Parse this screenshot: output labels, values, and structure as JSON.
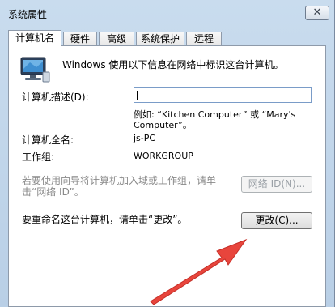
{
  "window": {
    "title": "系统属性"
  },
  "tabs": [
    {
      "label": "计算机名",
      "active": true
    },
    {
      "label": "硬件"
    },
    {
      "label": "高级"
    },
    {
      "label": "系统保护"
    },
    {
      "label": "远程"
    }
  ],
  "panel": {
    "intro": "Windows 使用以下信息在网络中标识这台计算机。",
    "desc_label": "计算机描述(D):",
    "desc_value": "",
    "example_line1": "例如: “Kitchen Computer” 或 “Mary's",
    "example_line2": "Computer”。",
    "fullname_label": "计算机全名:",
    "fullname_value": "js-PC",
    "workgroup_label": "工作组:",
    "workgroup_value": "WORKGROUP",
    "networkid_text_line1": "若要使用向导将计算机加入域或工作组，请单",
    "networkid_text_line2": "击“网络 ID”。",
    "networkid_button": "网络 ID(N)...",
    "rename_text": "要重命名这台计算机，请单击“更改”。",
    "change_button": "更改(C)..."
  },
  "colors": {
    "arrow": "#e8453c"
  }
}
